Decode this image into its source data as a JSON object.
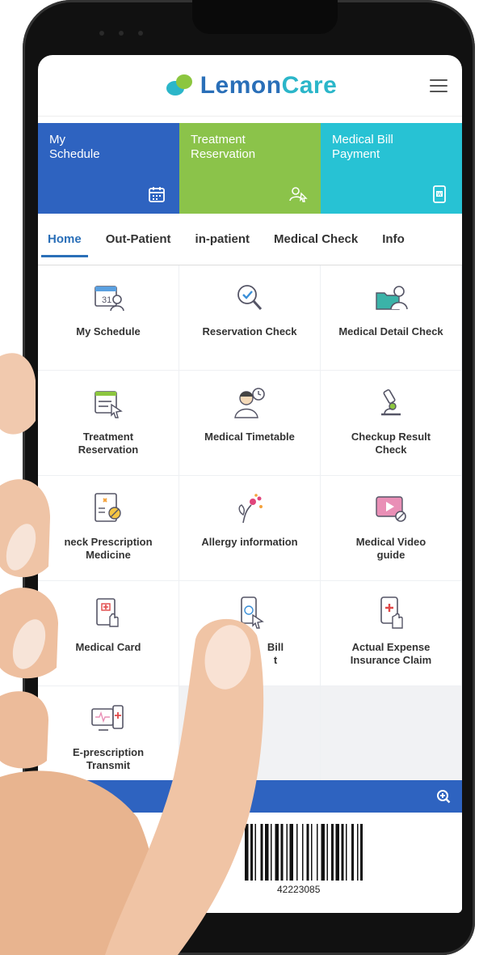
{
  "app": {
    "logo_lemon": "Lemon",
    "logo_care": "Care",
    "brand_colors": {
      "blue": "#2a6fb8",
      "teal": "#2bb6c9",
      "green": "#8cc63f"
    }
  },
  "banner": [
    {
      "line1": "My",
      "line2": "Schedule",
      "icon": "calendar-icon",
      "color": "#2e63c0"
    },
    {
      "line1": "Treatment",
      "line2": "Reservation",
      "icon": "person-pointer-icon",
      "color": "#8bc34a"
    },
    {
      "line1": "Medical Bill",
      "line2": "Payment",
      "icon": "phone-payment-icon",
      "color": "#27c2d4"
    }
  ],
  "tabs": [
    "Home",
    "Out-Patient",
    "in-patient",
    "Medical Check",
    "Info"
  ],
  "grid": [
    {
      "line1": "My Schedule",
      "line2": "",
      "icon": "calendar-person-icon"
    },
    {
      "line1": "Reservation Check",
      "line2": "",
      "icon": "search-check-icon"
    },
    {
      "line1": "Medical Detail Check",
      "line2": "",
      "icon": "folder-person-icon"
    },
    {
      "line1": "Treatment",
      "line2": "Reservation",
      "icon": "calendar-cursor-icon"
    },
    {
      "line1": "Medical Timetable",
      "line2": "",
      "icon": "doctor-clock-icon"
    },
    {
      "line1": "Checkup Result",
      "line2": "Check",
      "icon": "microscope-icon"
    },
    {
      "line1": "neck Prescription",
      "line2": "Medicine",
      "icon": "prescription-icon"
    },
    {
      "line1": "Allergy information",
      "line2": "",
      "icon": "allergy-flower-icon"
    },
    {
      "line1": "Medical Video",
      "line2": "guide",
      "icon": "video-icon"
    },
    {
      "line1": "Medical Card",
      "line2": "",
      "icon": "medical-card-icon"
    },
    {
      "line1": "Bill",
      "line2": "t",
      "icon": "phone-bill-icon"
    },
    {
      "line1": "Actual Expense",
      "line2": "Insurance Claim",
      "icon": "phone-cross-icon"
    },
    {
      "line1": "E-prescription",
      "line2": "Transmit",
      "icon": "monitor-transmit-icon"
    }
  ],
  "barcode": {
    "number": "42223085"
  }
}
